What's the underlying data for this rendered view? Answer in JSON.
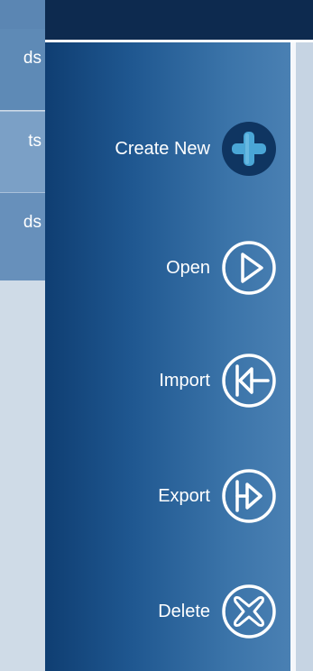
{
  "left_tabs": [
    {
      "label": "ds"
    },
    {
      "label": "ts"
    },
    {
      "label": "ds"
    }
  ],
  "menu": {
    "items": [
      {
        "label": "Create New",
        "icon": "plus-circle-icon"
      },
      {
        "label": "Open",
        "icon": "play-circle-icon"
      },
      {
        "label": "Import",
        "icon": "import-circle-icon"
      },
      {
        "label": "Export",
        "icon": "export-circle-icon"
      },
      {
        "label": "Delete",
        "icon": "delete-x-circle-icon"
      }
    ]
  },
  "colors": {
    "top_bar": "#0d2a4f",
    "panel_dark": "#0f3e72",
    "panel_light": "#4a80b3",
    "icon_stroke": "#ffffff",
    "create_icon_bg": "#0f3561",
    "create_plus": "#4aa6d6"
  }
}
